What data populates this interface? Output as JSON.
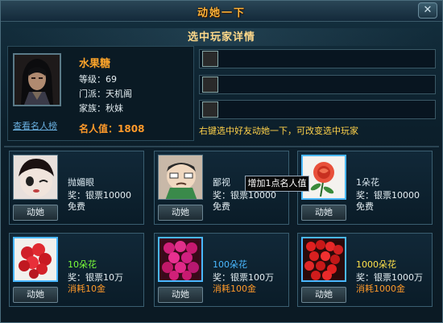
{
  "window": {
    "title": "动她一下",
    "close_label": "✕"
  },
  "section": {
    "title": "选中玩家详情"
  },
  "player": {
    "name": "水果糖",
    "rows": [
      {
        "label": "等级：",
        "value": "69"
      },
      {
        "label": "门派：",
        "value": "天机阁"
      },
      {
        "label": "家族：",
        "value": "秋妹"
      }
    ],
    "fame_label": "名人值：",
    "fame_value": "1808",
    "ranking_link": "查看名人榜"
  },
  "hint": "右键选中好友动她一下，可改变选中玩家",
  "tooltip": "增加1点名人值",
  "gifts": [
    {
      "name": "抛媚眼",
      "reward": "奖：银票10000",
      "cost": "免费",
      "button": "动她",
      "name_color": "#e4eef2",
      "cost_color": "#e4eef2",
      "thumb": "wink-face"
    },
    {
      "name": "鄙视",
      "reward": "奖：银票10000",
      "cost": "免费",
      "button": "动她",
      "name_color": "#e4eef2",
      "cost_color": "#e4eef2",
      "thumb": "scorn-face"
    },
    {
      "name": "1朵花",
      "reward": "奖：银票10000",
      "cost": "免费",
      "button": "动她",
      "name_color": "#e4eef2",
      "cost_color": "#e4eef2",
      "thumb": "single-rose"
    },
    {
      "name": "10朵花",
      "reward": "奖：银票10万",
      "cost": "消耗10金",
      "button": "动她",
      "name_color": "#7cff3a",
      "cost_color": "#ff9a2a",
      "thumb": "rose-bouquet-red"
    },
    {
      "name": "100朵花",
      "reward": "奖：银票100万",
      "cost": "消耗100金",
      "button": "动她",
      "name_color": "#4ab8ff",
      "cost_color": "#ff9a2a",
      "thumb": "rose-bouquet-pink"
    },
    {
      "name": "1000朵花",
      "reward": "奖：银票1000万",
      "cost": "消耗1000金",
      "button": "动她",
      "name_color": "#ffe24a",
      "cost_color": "#ff9a2a",
      "thumb": "rose-bouquet-large"
    }
  ]
}
